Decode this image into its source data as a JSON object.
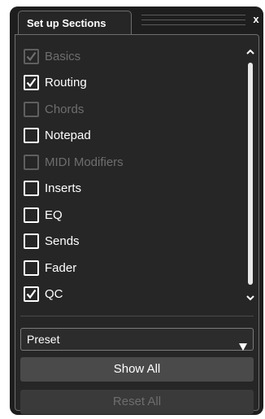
{
  "window": {
    "tab_title": "Set up Sections",
    "close_label": "x"
  },
  "sections": [
    {
      "label": "Basics",
      "checked": true,
      "enabled": false
    },
    {
      "label": "Routing",
      "checked": true,
      "enabled": true
    },
    {
      "label": "Chords",
      "checked": false,
      "enabled": false
    },
    {
      "label": "Notepad",
      "checked": false,
      "enabled": true
    },
    {
      "label": "MIDI Modifiers",
      "checked": false,
      "enabled": false
    },
    {
      "label": "Inserts",
      "checked": false,
      "enabled": true
    },
    {
      "label": "EQ",
      "checked": false,
      "enabled": true
    },
    {
      "label": "Sends",
      "checked": false,
      "enabled": true
    },
    {
      "label": "Fader",
      "checked": false,
      "enabled": true
    },
    {
      "label": "QC",
      "checked": true,
      "enabled": true
    }
  ],
  "preset": {
    "value": "Preset",
    "arrow_icon": "triangle-down-icon"
  },
  "buttons": {
    "show_all": "Show All",
    "reset_all": "Reset All"
  },
  "colors": {
    "background": "#1e1e1e",
    "panel": "#262626",
    "text": "#ffffff",
    "disabled_text": "#6e6e6e"
  }
}
